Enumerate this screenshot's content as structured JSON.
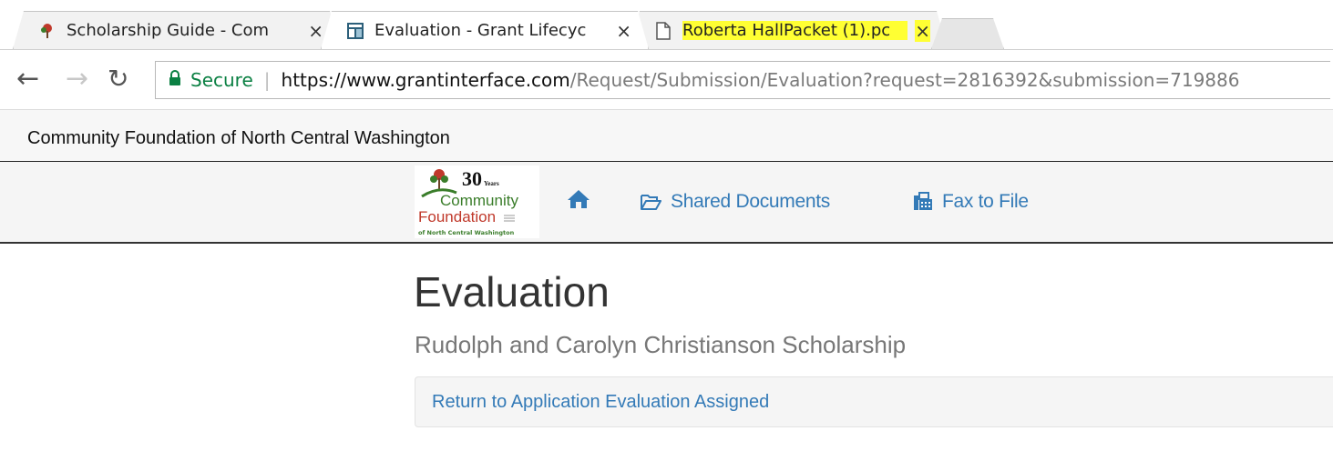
{
  "browser": {
    "tabs": [
      {
        "title": "Scholarship Guide - Com",
        "close": "×"
      },
      {
        "title": "Evaluation - Grant Lifecyc",
        "close": "×"
      },
      {
        "title": "Roberta HallPacket (1).pc",
        "close": "×"
      }
    ],
    "secure_label": "Secure",
    "url_host": "https://www.grantinterface.com",
    "url_path": "/Request/Submission/Evaluation?request=2816392&submission=719886"
  },
  "site": {
    "title": "Community Foundation of North Central Washington",
    "logo": {
      "years": "30",
      "years_small": "Years",
      "line1": "Community",
      "line2": "Foundation",
      "line3": "of North Central Washington"
    },
    "nav": {
      "home_icon": "home-icon",
      "shared_documents": "Shared Documents",
      "fax_to_file": "Fax to File"
    }
  },
  "main": {
    "title": "Evaluation",
    "subtitle": "Rudolph and Carolyn Christianson Scholarship",
    "breadcrumb_link": "Return to Application Evaluation Assigned"
  },
  "colors": {
    "link": "#337ab7",
    "secure": "#0b8043",
    "highlight": "#ffff33",
    "logo_green": "#3a7d2a",
    "logo_red": "#c0392b"
  }
}
